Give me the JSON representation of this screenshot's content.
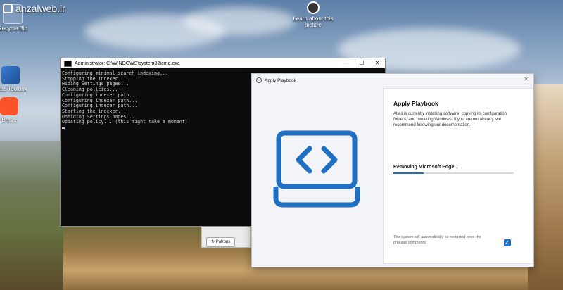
{
  "watermark": {
    "text": "anzalweb.ir"
  },
  "desktop": {
    "icons": [
      {
        "name": "recycle-bin",
        "label": "Recycle Bin"
      },
      {
        "name": "atlas-toolbox",
        "label": "Atlas Toolbox"
      },
      {
        "name": "brave",
        "label": "Brave"
      },
      {
        "name": "learn-about-this-picture",
        "label": "Learn about this picture"
      }
    ]
  },
  "cmd": {
    "title": "Administrator: C:\\WINDOWS\\system32\\cmd.exe",
    "controls": {
      "minimize": "—",
      "maximize": "☐",
      "close": "✕"
    },
    "lines": [
      "Configuring minimal search indexing...",
      "Stopping the indexer...",
      "Hiding Settings pages...",
      "Cleaning policies...",
      "Configuring indexer path...",
      "Configuring indexer path...",
      "Configuring indexer path...",
      "Starting the indexer...",
      "Unhiding Settings pages...",
      "Updating policy... (this might take a moment)"
    ]
  },
  "behind": {
    "patrons_label": "Patrons"
  },
  "playbook": {
    "window_title": "Apply Playbook",
    "close": "✕",
    "heading": "Apply Playbook",
    "description": "Atlas is currently installing software, copying its configuration folders, and tweaking Windows. If you are not already, we recommend following our documentation.",
    "step": "Removing Microsoft Edge...",
    "progress": 0.25,
    "note": "The system will automatically be restarted once the process completes.",
    "checkbox_checked": true,
    "accent": "#1f6fc2"
  }
}
